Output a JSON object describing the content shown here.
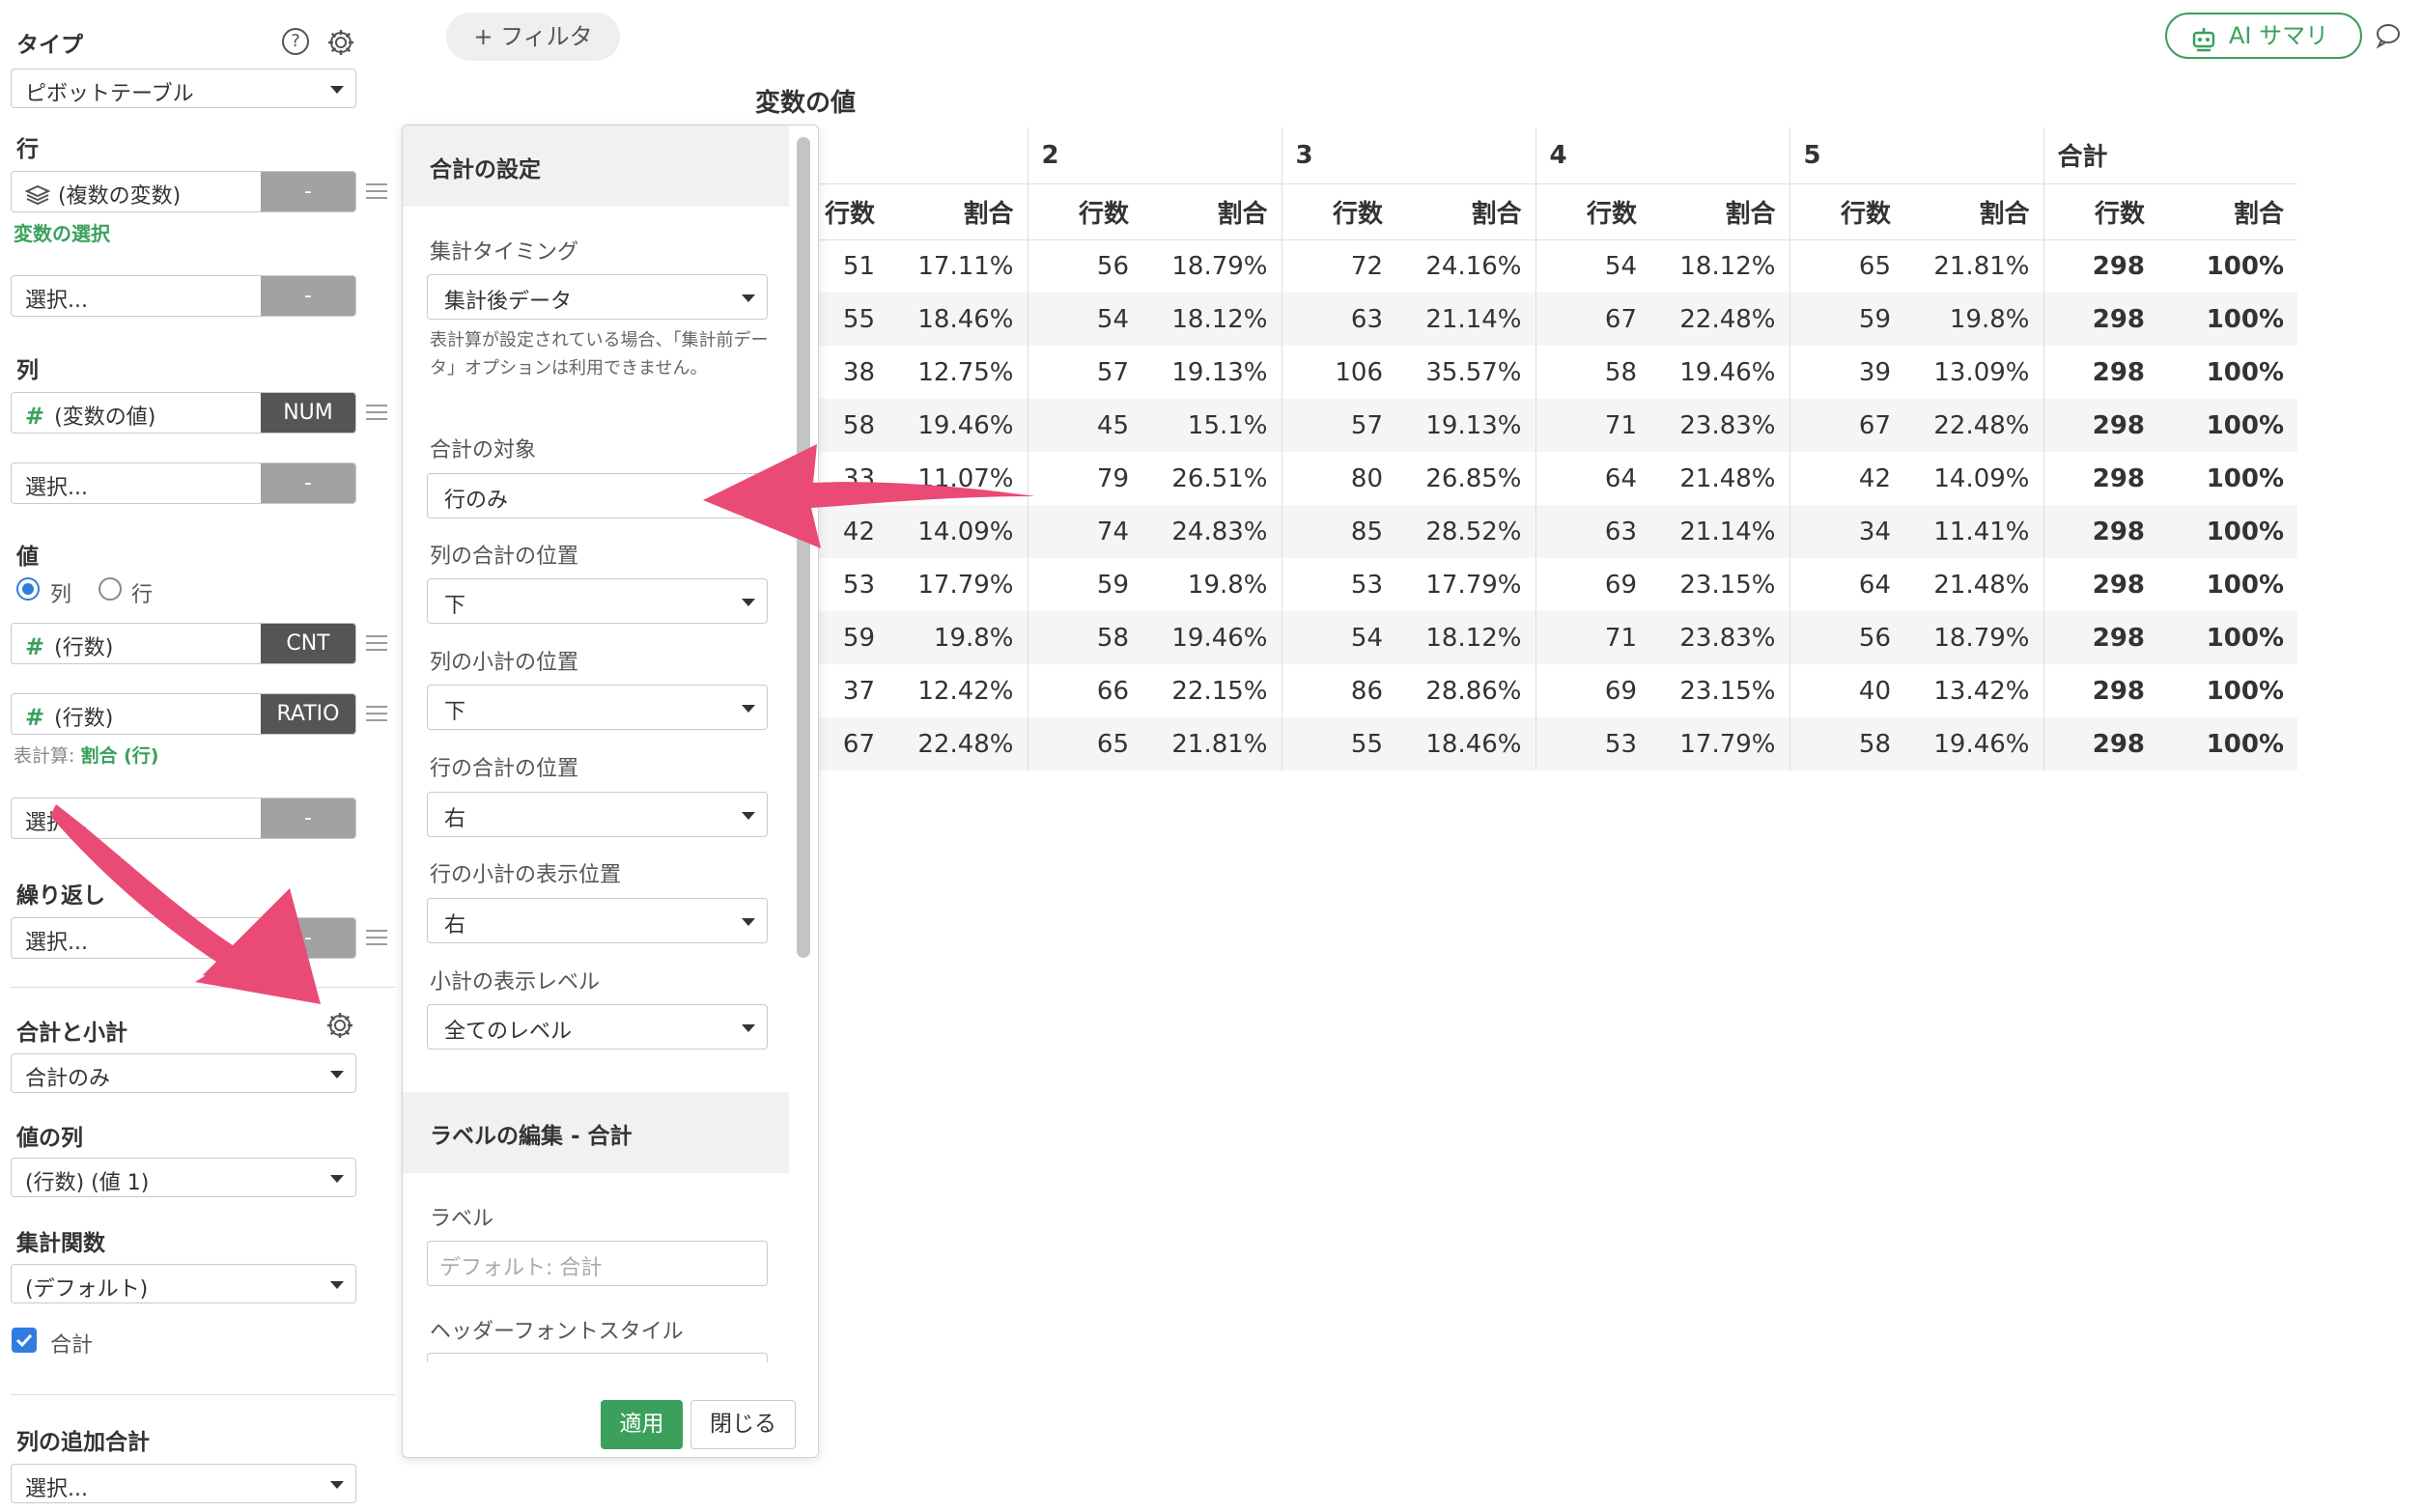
{
  "sidebar": {
    "type_label": "タイプ",
    "type_value": "ピボットテーブル",
    "rows_label": "行",
    "rows_pill": "(複数の変数)",
    "rows_tag": "-",
    "variable_select_link": "変数の選択",
    "rows_select": "選択...",
    "rows_select_tag": "-",
    "cols_label": "列",
    "cols_pill": "(変数の値)",
    "cols_tag": "NUM",
    "cols_select": "選択...",
    "cols_select_tag": "-",
    "values_label": "値",
    "radio_col": "列",
    "radio_row": "行",
    "value1_pill": "(行数)",
    "value1_tag": "CNT",
    "value2_pill": "(行数)",
    "value2_tag": "RATIO",
    "table_calc_prefix": "表計算:",
    "table_calc_value": "割合 (行)",
    "values_select": "選択...",
    "values_select_tag": "-",
    "repeat_label": "繰り返し",
    "repeat_select": "選択...",
    "repeat_select_tag": "-",
    "totals_label": "合計と小計",
    "totals_value": "合計のみ",
    "value_col_label": "値の列",
    "value_col_value": "(行数) (値 1)",
    "agg_label": "集計関数",
    "agg_value": "(デフォルト)",
    "total_checkbox_label": "合計",
    "col_extra_total_label": "列の追加合計",
    "col_extra_total_value": "選択..."
  },
  "topbar": {
    "filter_button": "+ フィルタ",
    "ai_button": "AI サマリ"
  },
  "panel": {
    "header": "合計の設定",
    "timing_label": "集計タイミング",
    "timing_value": "集計後データ",
    "timing_help": "表計算が設定されている場合、「集計前データ」オプションは利用できません。",
    "target_label": "合計の対象",
    "target_value": "行のみ",
    "col_total_pos_label": "列の合計の位置",
    "col_total_pos_value": "下",
    "col_subtotal_pos_label": "列の小計の位置",
    "col_subtotal_pos_value": "下",
    "row_total_pos_label": "行の合計の位置",
    "row_total_pos_value": "右",
    "row_subtotal_pos_label": "行の小計の表示位置",
    "row_subtotal_pos_value": "右",
    "subtotal_level_label": "小計の表示レベル",
    "subtotal_level_value": "全てのレベル",
    "label_section_header": "ラベルの編集 - 合計",
    "label_label": "ラベル",
    "label_placeholder": "デフォルト: 合計",
    "header_font_label": "ヘッダーフォントスタイル",
    "apply_button": "適用",
    "close_button": "閉じる"
  },
  "table": {
    "title": "変数の値",
    "groups": [
      "2",
      "3",
      "4",
      "5",
      "合計"
    ],
    "col_count": "行数",
    "col_ratio": "割合",
    "partial_count_header": "行数",
    "rows": [
      [
        "51",
        "17.11%",
        "56",
        "18.79%",
        "72",
        "24.16%",
        "54",
        "18.12%",
        "65",
        "21.81%",
        "298",
        "100%"
      ],
      [
        "55",
        "18.46%",
        "54",
        "18.12%",
        "63",
        "21.14%",
        "67",
        "22.48%",
        "59",
        "19.8%",
        "298",
        "100%"
      ],
      [
        "38",
        "12.75%",
        "57",
        "19.13%",
        "106",
        "35.57%",
        "58",
        "19.46%",
        "39",
        "13.09%",
        "298",
        "100%"
      ],
      [
        "58",
        "19.46%",
        "45",
        "15.1%",
        "57",
        "19.13%",
        "71",
        "23.83%",
        "67",
        "22.48%",
        "298",
        "100%"
      ],
      [
        "33",
        "11.07%",
        "79",
        "26.51%",
        "80",
        "26.85%",
        "64",
        "21.48%",
        "42",
        "14.09%",
        "298",
        "100%"
      ],
      [
        "42",
        "14.09%",
        "74",
        "24.83%",
        "85",
        "28.52%",
        "63",
        "21.14%",
        "34",
        "11.41%",
        "298",
        "100%"
      ],
      [
        "53",
        "17.79%",
        "59",
        "19.8%",
        "53",
        "17.79%",
        "69",
        "23.15%",
        "64",
        "21.48%",
        "298",
        "100%"
      ],
      [
        "59",
        "19.8%",
        "58",
        "19.46%",
        "54",
        "18.12%",
        "71",
        "23.83%",
        "56",
        "18.79%",
        "298",
        "100%"
      ],
      [
        "37",
        "12.42%",
        "66",
        "22.15%",
        "86",
        "28.86%",
        "69",
        "23.15%",
        "40",
        "13.42%",
        "298",
        "100%"
      ],
      [
        "67",
        "22.48%",
        "65",
        "21.81%",
        "55",
        "18.46%",
        "53",
        "17.79%",
        "58",
        "19.46%",
        "298",
        "100%"
      ]
    ]
  },
  "colors": {
    "accent_green": "#3aa05c",
    "annotation_arrow": "#ea4a76",
    "radio_blue": "#2f7de1"
  }
}
